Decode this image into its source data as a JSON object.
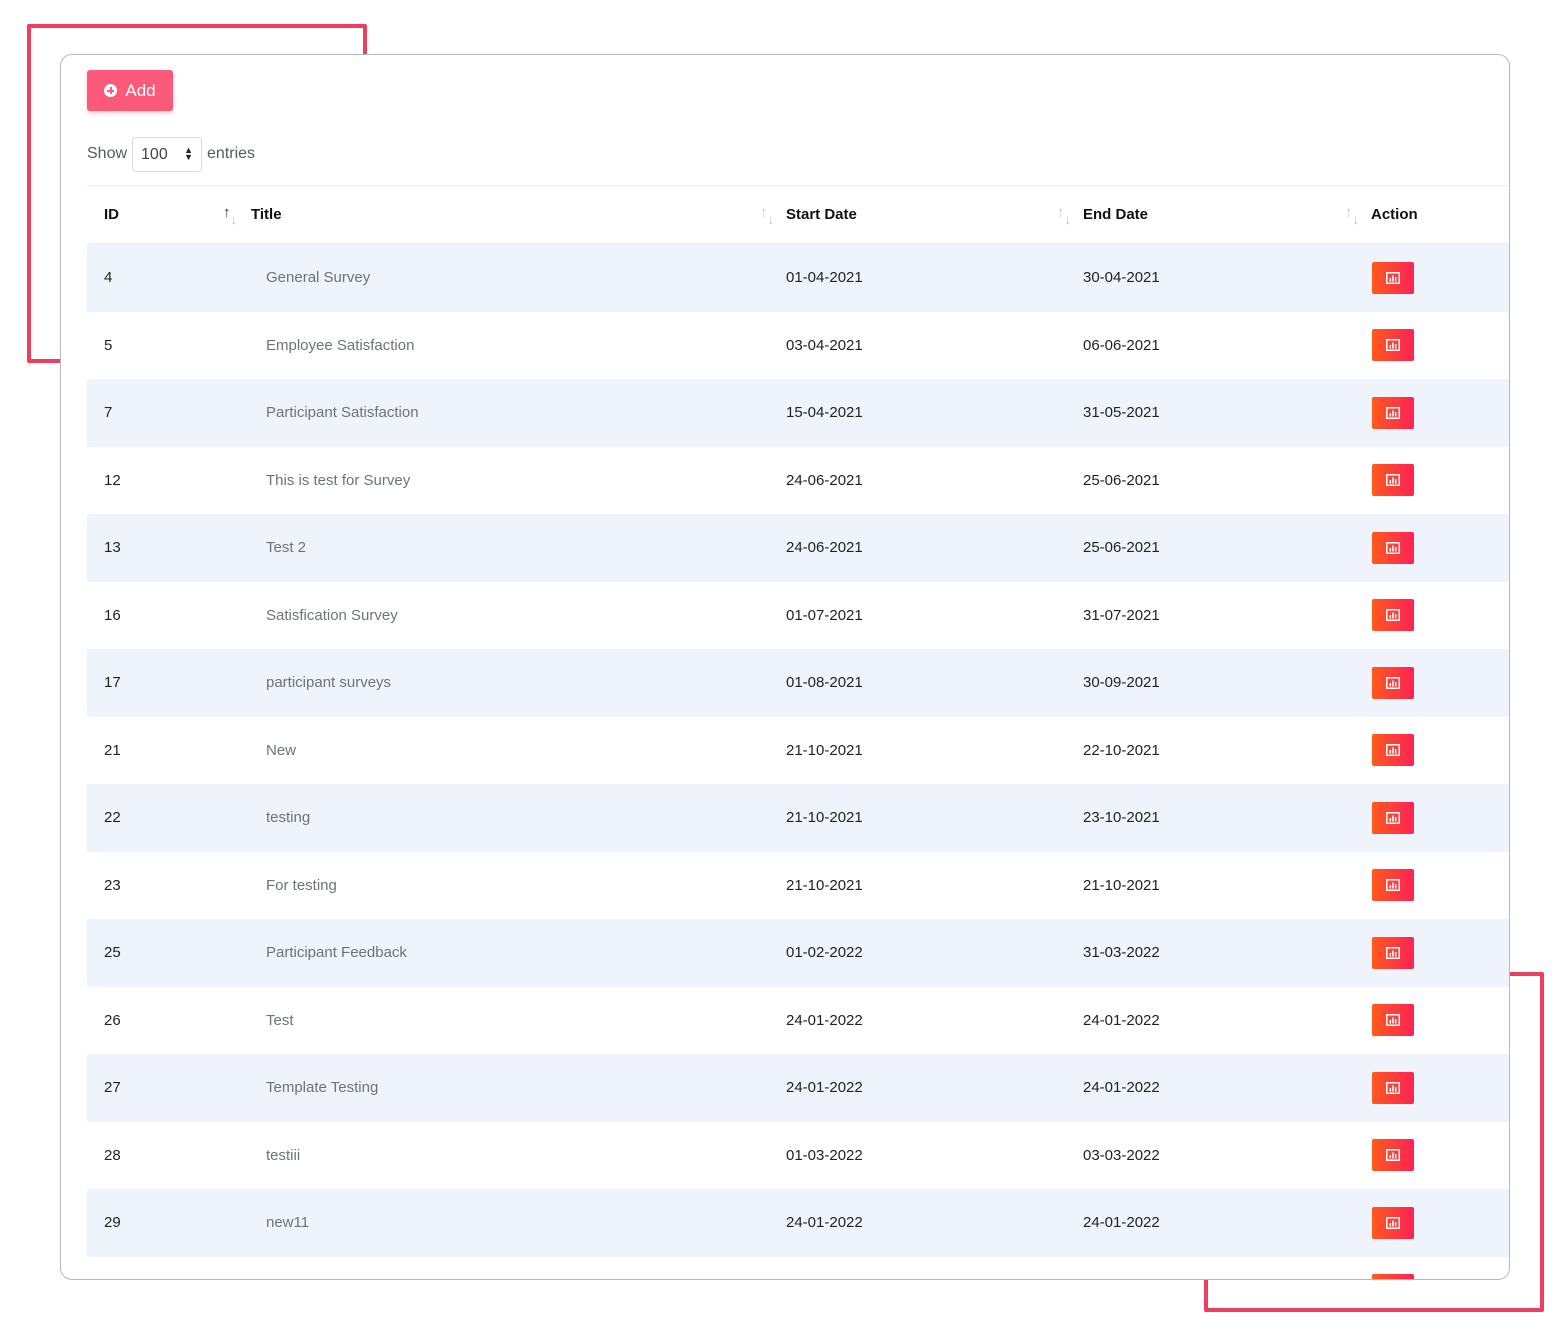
{
  "toolbar": {
    "add_label": "Add",
    "add_icon": "plus-circle-icon"
  },
  "length_menu": {
    "show_label": "Show",
    "entries_label": "entries",
    "selected": "100"
  },
  "table": {
    "columns": [
      {
        "label": "ID",
        "sortable": true,
        "sorted": "asc"
      },
      {
        "label": "Title",
        "sortable": true
      },
      {
        "label": "Start Date",
        "sortable": true
      },
      {
        "label": "End Date",
        "sortable": true
      },
      {
        "label": "Action",
        "sortable": false
      }
    ],
    "rows": [
      {
        "id": "4",
        "title": "General Survey",
        "start": "01-04-2021",
        "end": "30-04-2021"
      },
      {
        "id": "5",
        "title": "Employee Satisfaction",
        "start": "03-04-2021",
        "end": "06-06-2021"
      },
      {
        "id": "7",
        "title": "Participant Satisfaction",
        "start": "15-04-2021",
        "end": "31-05-2021"
      },
      {
        "id": "12",
        "title": "This is test for Survey",
        "start": "24-06-2021",
        "end": "25-06-2021"
      },
      {
        "id": "13",
        "title": "Test 2",
        "start": "24-06-2021",
        "end": "25-06-2021"
      },
      {
        "id": "16",
        "title": "Satisfication Survey",
        "start": "01-07-2021",
        "end": "31-07-2021"
      },
      {
        "id": "17",
        "title": "participant surveys",
        "start": "01-08-2021",
        "end": "30-09-2021"
      },
      {
        "id": "21",
        "title": "New",
        "start": "21-10-2021",
        "end": "22-10-2021"
      },
      {
        "id": "22",
        "title": "testing",
        "start": "21-10-2021",
        "end": "23-10-2021"
      },
      {
        "id": "23",
        "title": "For testing",
        "start": "21-10-2021",
        "end": "21-10-2021"
      },
      {
        "id": "25",
        "title": "Participant Feedback",
        "start": "01-02-2022",
        "end": "31-03-2022"
      },
      {
        "id": "26",
        "title": "Test",
        "start": "24-01-2022",
        "end": "24-01-2022"
      },
      {
        "id": "27",
        "title": "Template Testing",
        "start": "24-01-2022",
        "end": "24-01-2022"
      },
      {
        "id": "28",
        "title": "testiii",
        "start": "01-03-2022",
        "end": "03-03-2022"
      },
      {
        "id": "29",
        "title": "new11",
        "start": "24-01-2022",
        "end": "24-01-2022"
      },
      {
        "id": "",
        "title": "",
        "start": "",
        "end": ""
      }
    ],
    "action_icon": "bar-chart-icon"
  },
  "colors": {
    "accent_frame": "#ee3e5e",
    "add_button": "#fc5a7a",
    "action_gradient_start": "#ff5a1e",
    "action_gradient_end": "#ff2255",
    "row_stripe": "#eff3fb"
  }
}
